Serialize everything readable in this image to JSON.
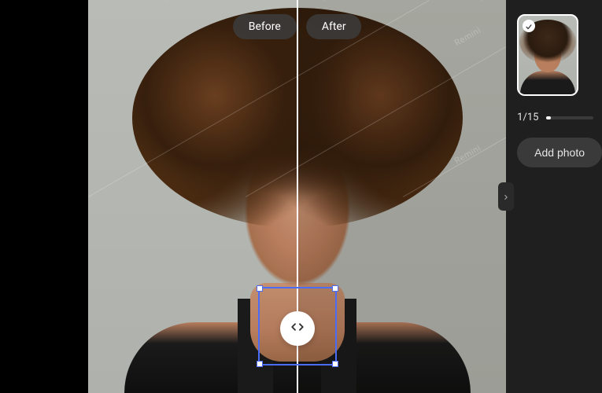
{
  "comparison": {
    "before_label": "Before",
    "after_label": "After",
    "watermark_text": "Remini"
  },
  "sidebar": {
    "counter": "1/15",
    "add_button_label": "Add photo"
  }
}
